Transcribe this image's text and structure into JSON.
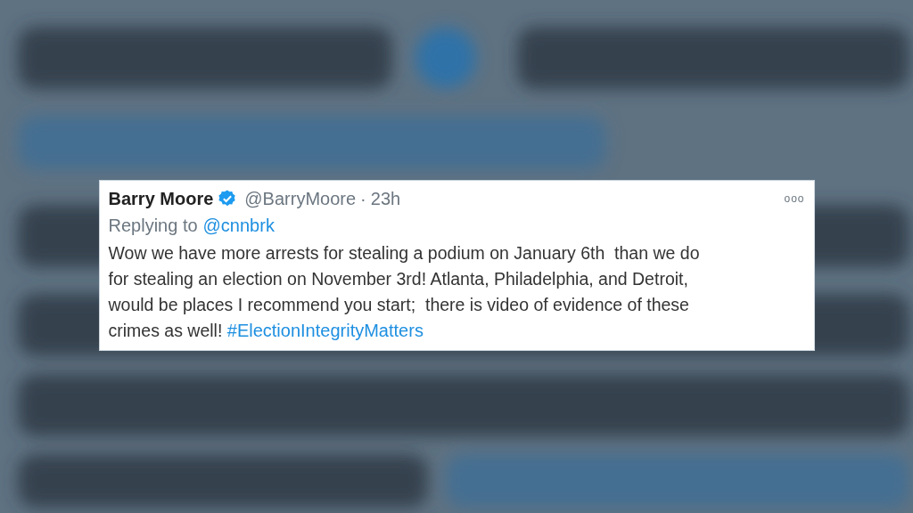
{
  "tweet": {
    "name": "Barry Moore",
    "verified": true,
    "handle": "@BarryMoore",
    "separator": "·",
    "time": "23h",
    "more": "ooo",
    "reply_prefix": "Replying to",
    "reply_to": "@cnnbrk",
    "body_lines": [
      "Wow we have more arrests for stealing a podium on January 6th  than we do",
      "for stealing an election on November 3rd! Atlanta, Philadelphia, and Detroit,",
      "would be places I recommend you start;  there is video of evidence of these",
      "crimes as well! "
    ],
    "hashtag": "#ElectionIntegrityMatters"
  }
}
